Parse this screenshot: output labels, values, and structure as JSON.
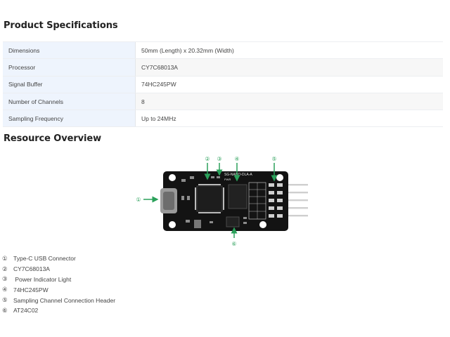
{
  "specs": {
    "heading": "Product Specifications",
    "rows": [
      {
        "label": "Dimensions",
        "value": "50mm (Length) x 20.32mm (Width)"
      },
      {
        "label": "Processor",
        "value": "CY7C68013A"
      },
      {
        "label": "Signal Buffer",
        "value": "74HC245PW"
      },
      {
        "label": "Number of Channels",
        "value": "8"
      },
      {
        "label": "Sampling Frequency",
        "value": "Up to 24MHz"
      }
    ]
  },
  "resources": {
    "heading": "Resource Overview",
    "board": {
      "silkscreen": "SG-NANO-DLA-A",
      "pwr_label": "PWR",
      "callouts": [
        "①",
        "②",
        "③",
        "④",
        "⑤",
        "⑥"
      ]
    },
    "items": [
      {
        "num": "①",
        "text": "Type-C USB Connector"
      },
      {
        "num": "②",
        "text": "CY7C68013A"
      },
      {
        "num": "③",
        "text": " Power Indicator Light"
      },
      {
        "num": "④",
        "text": "74HC245PW"
      },
      {
        "num": "⑤",
        "text": "Sampling Channel Connection Header"
      },
      {
        "num": "⑥",
        "text": "AT24C02"
      }
    ]
  },
  "colors": {
    "key_cell_bg": "#eef4fd",
    "board": "#131313",
    "callout_green": "#2aa05a"
  }
}
